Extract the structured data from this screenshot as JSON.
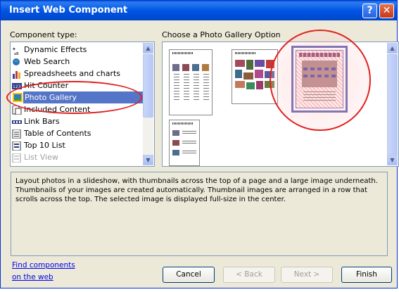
{
  "window": {
    "title": "Insert Web Component"
  },
  "left": {
    "label": "Component type:",
    "items": [
      {
        "label": "Dynamic Effects",
        "icon": "effects-icon"
      },
      {
        "label": "Web Search",
        "icon": "web-search-icon"
      },
      {
        "label": "Spreadsheets and charts",
        "icon": "spreadsheet-icon"
      },
      {
        "label": "Hit Counter",
        "icon": "hit-counter-icon"
      },
      {
        "label": "Photo Gallery",
        "icon": "photo-gallery-icon"
      },
      {
        "label": "Included Content",
        "icon": "included-content-icon"
      },
      {
        "label": "Link Bars",
        "icon": "link-bars-icon"
      },
      {
        "label": "Table of Contents",
        "icon": "toc-icon"
      },
      {
        "label": "Top 10 List",
        "icon": "top10-icon"
      },
      {
        "label": "List View",
        "icon": "list-view-icon"
      }
    ]
  },
  "right": {
    "label": "Choose a Photo Gallery Option"
  },
  "description": "Layout photos in a slideshow, with thumbnails across the top of a page and a large image underneath.  Thumbnails of your images are created automatically. Thumbnail images are arranged in a row that scrolls across the top. The selected image is displayed full-size in the center.",
  "find_link": {
    "line1": "Find components",
    "line2": "on the web"
  },
  "buttons": {
    "cancel": "Cancel",
    "back": "< Back",
    "next": "Next >",
    "finish": "Finish"
  },
  "colors": {
    "selection": "#5575c8",
    "annotation": "#e02020",
    "title_bar": "#0055e5"
  }
}
